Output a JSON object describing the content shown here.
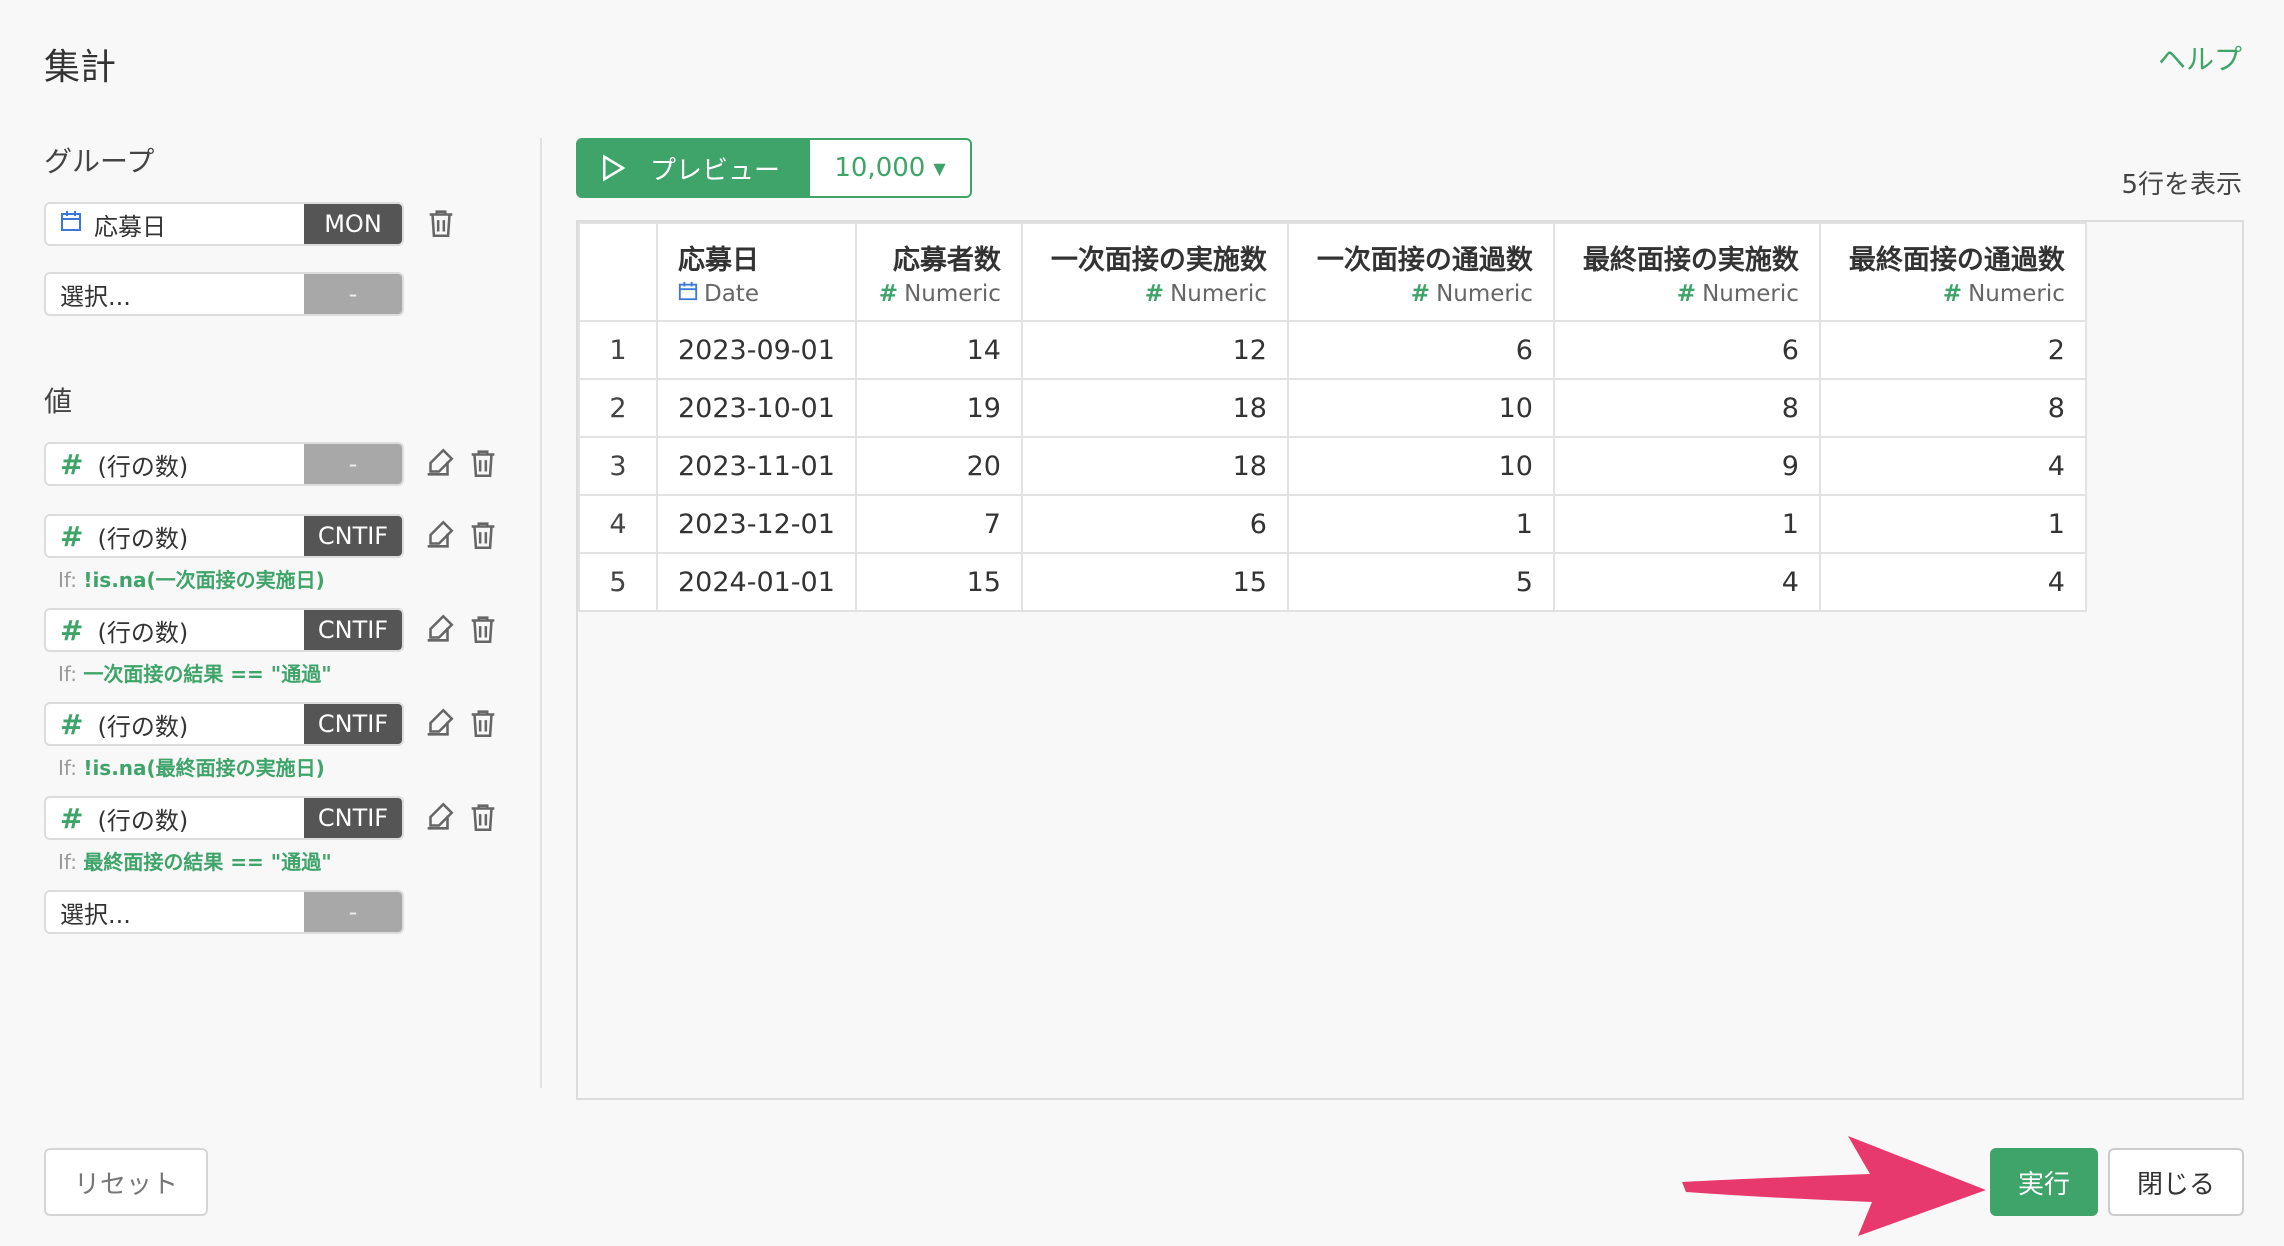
{
  "dialog": {
    "title": "集計",
    "help": "ヘルプ"
  },
  "group": {
    "label": "グループ",
    "items": [
      {
        "name": "応募日",
        "func": "MON"
      },
      {
        "name": "選択...",
        "func": "-"
      }
    ]
  },
  "values": {
    "label": "値",
    "items": [
      {
        "name": "(行の数)",
        "func": "-"
      },
      {
        "name": "(行の数)",
        "func": "CNTIF",
        "cond_prefix": "If:",
        "cond": "!is.na(一次面接の実施日)"
      },
      {
        "name": "(行の数)",
        "func": "CNTIF",
        "cond_prefix": "If:",
        "cond": "一次面接の結果 == \"通過\""
      },
      {
        "name": "(行の数)",
        "func": "CNTIF",
        "cond_prefix": "If:",
        "cond": "!is.na(最終面接の実施日)"
      },
      {
        "name": "(行の数)",
        "func": "CNTIF",
        "cond_prefix": "If:",
        "cond": "最終面接の結果 == \"通過\""
      },
      {
        "name": "選択...",
        "func": "-"
      }
    ]
  },
  "preview": {
    "label": "プレビュー",
    "rows": "10,000",
    "rowcount_text": "5行を表示"
  },
  "table": {
    "columns": [
      {
        "name": "応募日",
        "type": "Date"
      },
      {
        "name": "応募者数",
        "type": "Numeric"
      },
      {
        "name": "一次面接の実施数",
        "type": "Numeric"
      },
      {
        "name": "一次面接の通過数",
        "type": "Numeric"
      },
      {
        "name": "最終面接の実施数",
        "type": "Numeric"
      },
      {
        "name": "最終面接の通過数",
        "type": "Numeric"
      }
    ],
    "rows": [
      [
        "1",
        "2023-09-01",
        "14",
        "12",
        "6",
        "6",
        "2"
      ],
      [
        "2",
        "2023-10-01",
        "19",
        "18",
        "10",
        "8",
        "8"
      ],
      [
        "3",
        "2023-11-01",
        "20",
        "18",
        "10",
        "9",
        "4"
      ],
      [
        "4",
        "2023-12-01",
        "7",
        "6",
        "1",
        "1",
        "1"
      ],
      [
        "5",
        "2024-01-01",
        "15",
        "15",
        "5",
        "4",
        "4"
      ]
    ]
  },
  "footer": {
    "reset": "リセット",
    "run": "実行",
    "close": "閉じる"
  },
  "colors": {
    "accent": "#3fa46a",
    "arrow": "#e8396f",
    "func_button": "#555555"
  }
}
